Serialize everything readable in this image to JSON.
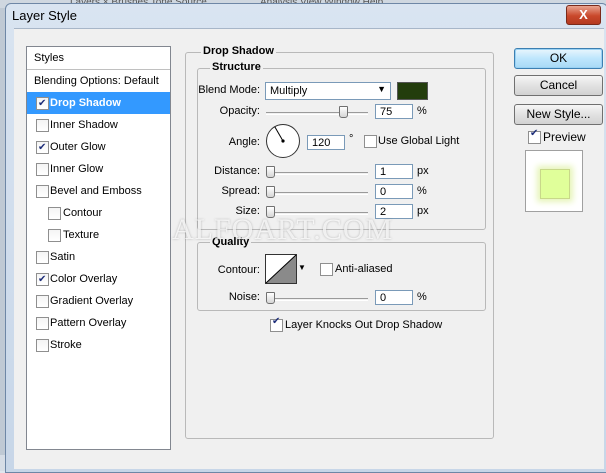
{
  "background": {
    "tabs_text": "Layers × Brushes Tone Source",
    "right_text": "Analysis View Window Help"
  },
  "window": {
    "title": "Layer Style",
    "close_label": "X"
  },
  "styles_list": {
    "header": "Styles",
    "items": [
      {
        "label": "Blending Options: Default",
        "checkbox": false,
        "checked": false
      },
      {
        "label": "Drop Shadow",
        "checkbox": true,
        "checked": true,
        "selected": true
      },
      {
        "label": "Inner Shadow",
        "checkbox": true,
        "checked": false
      },
      {
        "label": "Outer Glow",
        "checkbox": true,
        "checked": true
      },
      {
        "label": "Inner Glow",
        "checkbox": true,
        "checked": false
      },
      {
        "label": "Bevel and Emboss",
        "checkbox": true,
        "checked": false
      },
      {
        "label": "Contour",
        "checkbox": true,
        "checked": false,
        "sub": true
      },
      {
        "label": "Texture",
        "checkbox": true,
        "checked": false,
        "sub": true
      },
      {
        "label": "Satin",
        "checkbox": true,
        "checked": false
      },
      {
        "label": "Color Overlay",
        "checkbox": true,
        "checked": true
      },
      {
        "label": "Gradient Overlay",
        "checkbox": true,
        "checked": false
      },
      {
        "label": "Pattern Overlay",
        "checkbox": true,
        "checked": false
      },
      {
        "label": "Stroke",
        "checkbox": true,
        "checked": false
      }
    ]
  },
  "drop_shadow": {
    "title": "Drop Shadow",
    "structure": {
      "title": "Structure",
      "blend_mode_label": "Blend Mode:",
      "blend_mode_value": "Multiply",
      "shadow_color": "#233d0c",
      "opacity_label": "Opacity:",
      "opacity_value": "75",
      "opacity_fraction": 0.75,
      "opacity_unit": "%",
      "angle_label": "Angle:",
      "angle_value": "120",
      "angle_unit": "°",
      "use_global_light_label": "Use Global Light",
      "use_global_light_checked": false,
      "distance_label": "Distance:",
      "distance_value": "1",
      "distance_unit": "px",
      "spread_label": "Spread:",
      "spread_value": "0",
      "spread_unit": "%",
      "size_label": "Size:",
      "size_value": "2",
      "size_unit": "px"
    },
    "quality": {
      "title": "Quality",
      "contour_label": "Contour:",
      "anti_aliased_label": "Anti-aliased",
      "anti_aliased_checked": false,
      "noise_label": "Noise:",
      "noise_value": "0",
      "noise_unit": "%"
    },
    "layer_knocks_out_label": "Layer Knocks Out Drop Shadow",
    "layer_knocks_out_checked": true
  },
  "buttons": {
    "ok": "OK",
    "cancel": "Cancel",
    "new_style": "New Style...",
    "preview_label": "Preview",
    "preview_checked": true,
    "preview_color": "#e0ff9a"
  },
  "watermark": "ALFOART.COM",
  "colors": {
    "selection": "#3399ff",
    "dialog_bg": "#f0f0f0"
  }
}
